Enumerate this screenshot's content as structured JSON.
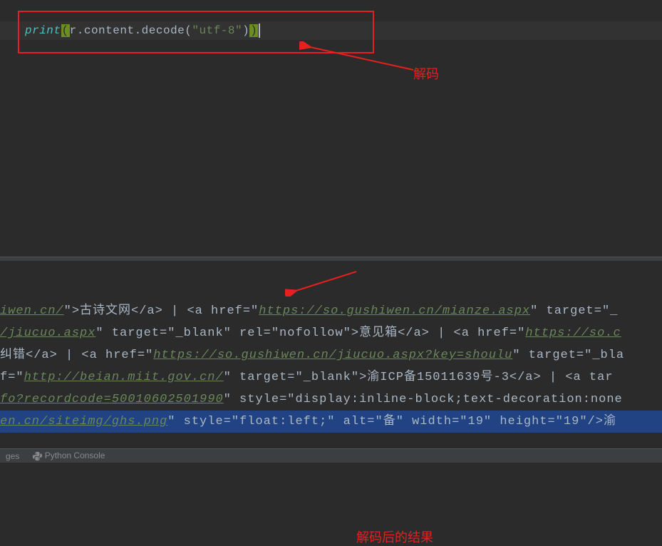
{
  "code": {
    "func": "print",
    "open_paren": "(",
    "var": "r",
    "dot1": ".",
    "prop1": "content",
    "dot2": ".",
    "method": "decode",
    "open_paren2": "(",
    "string": "\"utf-8\"",
    "close_paren2": ")",
    "close_paren": ")"
  },
  "annotations": {
    "decode_label": "解码",
    "result_label": "解码后的结果"
  },
  "output": {
    "line1_url": "iwen.cn/",
    "line1_a": "\">古诗文网</a> | <a href=\"",
    "line1_url2": "https://so.gushiwen.cn/mianze.aspx",
    "line1_b": "\" target=\"_",
    "line2_url": "/jiucuo.aspx",
    "line2_a": "\" target=\"_blank\" rel=\"nofollow\">意见箱</a> | <a href=\"",
    "line2_url2": "https://so.c",
    "line3_a": "纠错</a> | <a href=\"",
    "line3_url": "https://so.gushiwen.cn/jiucuo.aspx?key=shoulu",
    "line3_b": "\" target=\"_bla",
    "line4_a": "f=\"",
    "line4_url": "http://beian.miit.gov.cn/",
    "line4_b": "\" target=\"_blank\">渝ICP备15011639号-3</a> | <a tar",
    "line5_url": "fo?recordcode=50010602501990",
    "line5_a": "\" style=\"display:inline-block;text-decoration:none",
    "line6_url": "en.cn/siteimg/ghs.png",
    "line6_a": "\" style=\"float:left;\" alt=\"备\" width=\"19\" height=\"19\"/>渝"
  },
  "bottom": {
    "item1": "ges",
    "item2": "Python Console"
  }
}
